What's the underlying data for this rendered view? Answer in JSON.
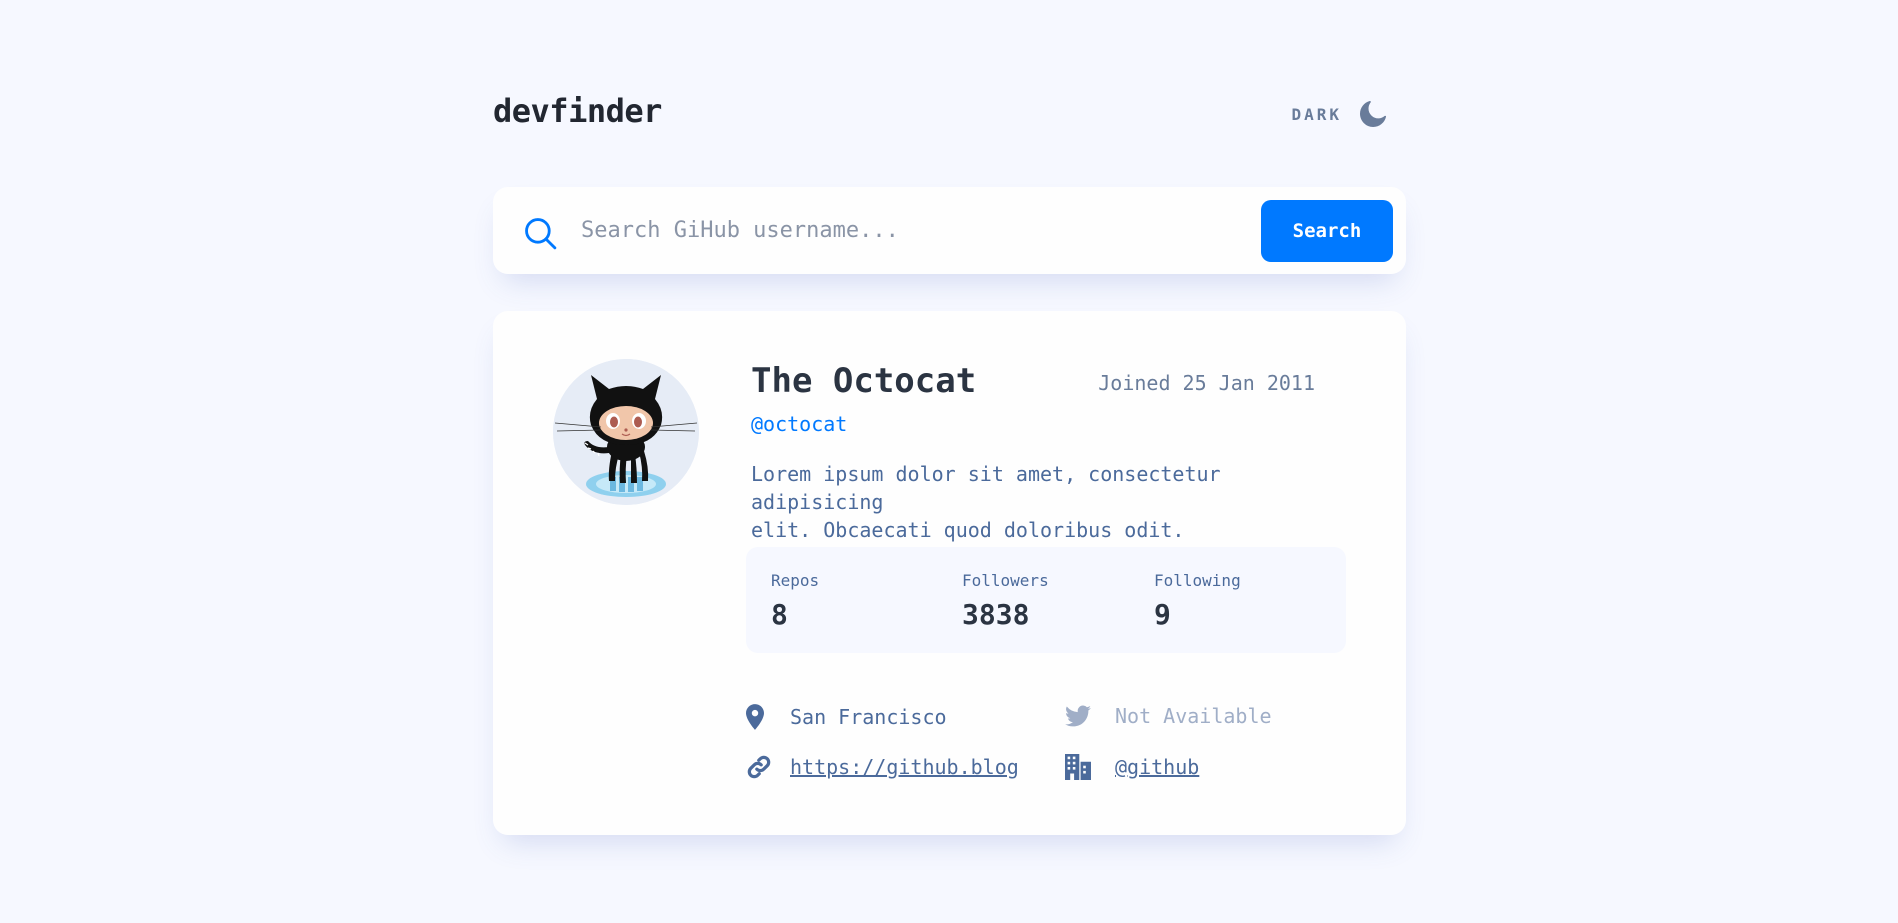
{
  "header": {
    "logo": "devfinder",
    "theme_toggle_label": "DARK",
    "theme_icon": "moon-icon"
  },
  "search": {
    "placeholder": "Search GiHub username...",
    "value": "",
    "button_label": "Search",
    "icon": "search-icon"
  },
  "profile": {
    "name": "The Octocat",
    "joined": "Joined 25 Jan 2011",
    "login": "@octocat",
    "bio_line1": "Lorem ipsum dolor sit amet, consectetur adipisicing",
    "bio_line2": "elit. Obcaecati quod doloribus odit.",
    "stats": [
      {
        "label": "Repos",
        "value": "8"
      },
      {
        "label": "Followers",
        "value": "3838"
      },
      {
        "label": "Following",
        "value": "9"
      }
    ],
    "links": {
      "location": {
        "icon": "location-pin-icon",
        "text": "San Francisco"
      },
      "twitter": {
        "icon": "twitter-icon",
        "text": "Not Available"
      },
      "website": {
        "icon": "link-icon",
        "text": "https://github.blog"
      },
      "company": {
        "icon": "office-building-icon",
        "text": "@github"
      }
    }
  },
  "colors": {
    "background": "#f6f8ff",
    "card": "#fefefe",
    "accent": "#0079ff",
    "text_primary": "#2b3442",
    "text_secondary": "#4b6a9b",
    "muted": "#697c9a"
  }
}
